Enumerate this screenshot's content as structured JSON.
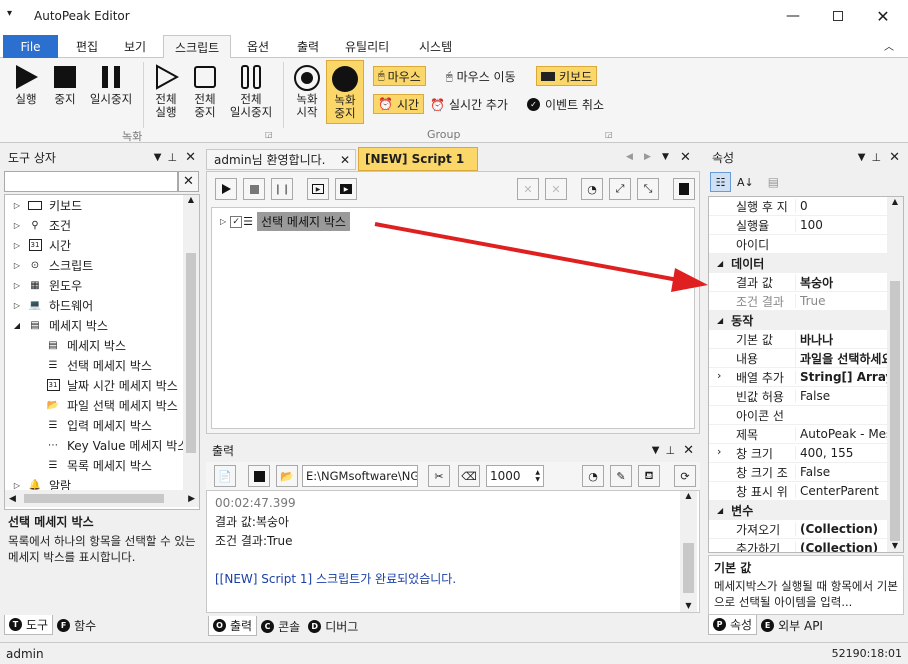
{
  "app": {
    "title": "AutoPeak Editor",
    "status_user": "admin",
    "status_time": "52190:18:01"
  },
  "menu": [
    "File",
    "편집",
    "보기",
    "스크립트",
    "옵션",
    "출력",
    "유틸리티",
    "시스템"
  ],
  "ribbon": {
    "run": "실행",
    "stop": "중지",
    "pause": "일시중지",
    "run_all_1": "전체",
    "run_all_2": "실행",
    "stop_all_1": "전체",
    "stop_all_2": "중지",
    "pause_all_1": "전체",
    "pause_all_2": "일시중지",
    "rec_start_1": "녹화",
    "rec_start_2": "시작",
    "rec_stop_1": "녹화",
    "rec_stop_2": "중지",
    "mouse": "마우스",
    "mouse_move": "마우스 이동",
    "keyboard": "키보드",
    "time": "시간",
    "realtime_add": "실시간 추가",
    "event_cancel": "이벤트 취소",
    "group_record": "녹화",
    "group_group": "Group"
  },
  "toolbox": {
    "title": "도구 상자",
    "items": [
      "키보드",
      "조건",
      "시간",
      "스크립트",
      "윈도우",
      "하드웨어",
      "메세지 박스"
    ],
    "subitems": [
      "메세지 박스",
      "선택 메세지 박스",
      "날짜 시간 메세지 박스",
      "파일 선택 메세지 박스",
      "입력 메세지 박스",
      "Key Value 메세지 박스",
      "목록 메세지 박스"
    ],
    "last_item": "알람",
    "desc_title": "선택 메세지 박스",
    "desc_text": "목록에서 하나의 항목을 선택할 수 있는 메세지 박스를 표시합니다.",
    "tab_tools": "도구",
    "tab_funcs": "함수"
  },
  "editor": {
    "tab1": "admin님 환영합니다.",
    "tab2": "[NEW] Script 1",
    "node": "선택 메세지 박스"
  },
  "output": {
    "title": "출력",
    "path": "E:\\NGMsoftware\\NG",
    "count": "1000",
    "time": "00:02:47.399",
    "line1": "결과 값:복숭아",
    "line2": "조건 결과:True",
    "done": "[[NEW] Script 1] 스크립트가 완료되었습니다.",
    "tab_output": "출력",
    "tab_console": "콘솔",
    "tab_debug": "디버그"
  },
  "props": {
    "title": "속성",
    "rows_top": [
      [
        "실행 후 지",
        "0"
      ],
      [
        "실행율",
        "100"
      ],
      [
        "아이디",
        ""
      ]
    ],
    "cat_data": "데이터",
    "rows_data": [
      [
        "결과 값",
        "복숭아",
        "b"
      ],
      [
        "조건 결과",
        "True",
        "g"
      ]
    ],
    "cat_action": "동작",
    "rows_action": [
      [
        "기본 값",
        "바나나",
        "b",
        ""
      ],
      [
        "내용",
        "과일을 선택하세요",
        "b",
        ""
      ],
      [
        "배열 추가",
        "String[] Array",
        "b",
        "›"
      ],
      [
        "빈값 허용",
        "False",
        "",
        ""
      ],
      [
        "아이콘 선",
        "",
        "",
        ""
      ],
      [
        "제목",
        "AutoPeak - Messa",
        "",
        ""
      ],
      [
        "창 크기",
        "400, 155",
        "",
        "›"
      ],
      [
        "창 크기 조",
        "False",
        "",
        ""
      ],
      [
        "창 표시 위",
        "CenterParent",
        "",
        ""
      ]
    ],
    "cat_vars": "변수",
    "rows_vars": [
      [
        "가져오기",
        "(Collection)",
        "b"
      ],
      [
        "추가하기",
        "(Collection)",
        "b"
      ]
    ],
    "desc_title": "기본 값",
    "desc_text": "메세지박스가 실행될 때 항목에서 기본으로 선택될 아이템을 입력...",
    "tab_props": "속성",
    "tab_api": "외부 API"
  },
  "colors": {
    "accent": "#2b6fcf",
    "highlight": "#fbd76a",
    "arrow": "#e02020",
    "link": "#1a3fa8"
  }
}
